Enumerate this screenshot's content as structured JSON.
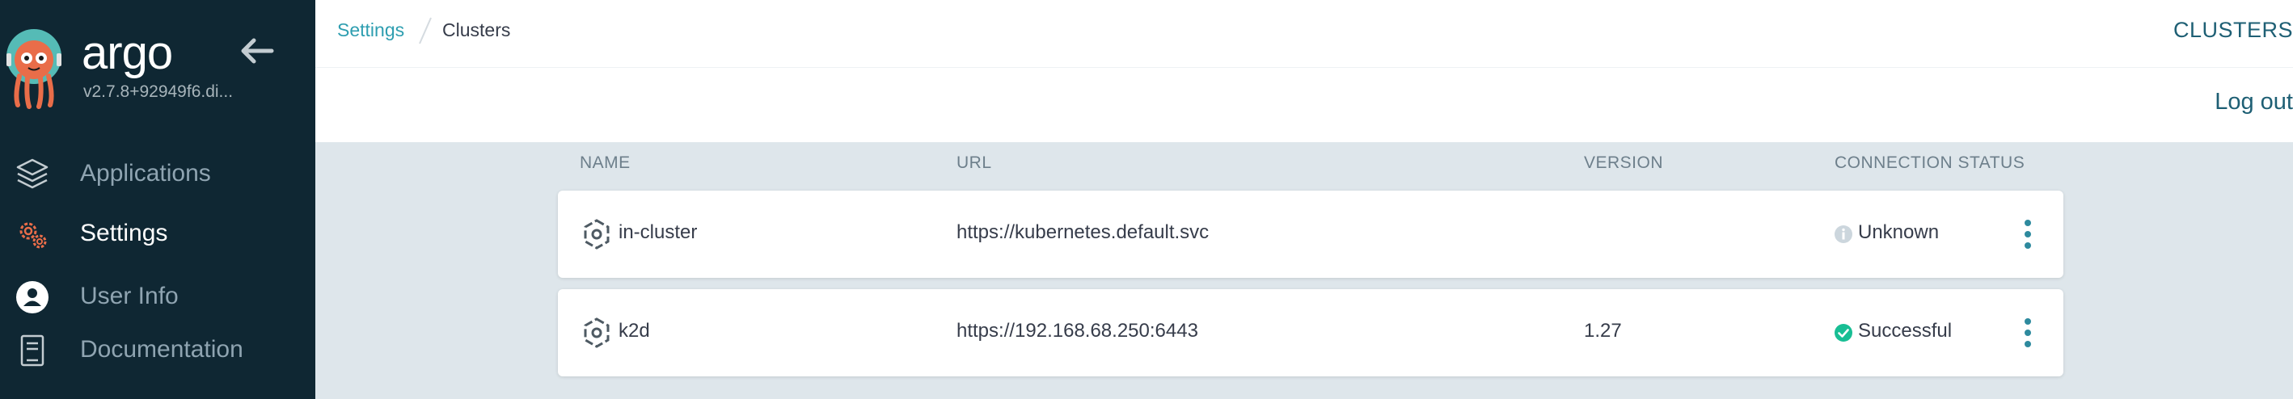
{
  "sidebar": {
    "brand": "argo",
    "version": "v2.7.8+92949f6.di...",
    "items": [
      {
        "label": "Applications",
        "icon": "layers-icon",
        "active": false
      },
      {
        "label": "Settings",
        "icon": "gears-icon",
        "active": true
      },
      {
        "label": "User Info",
        "icon": "user-circle-icon",
        "active": false
      },
      {
        "label": "Documentation",
        "icon": "book-icon",
        "active": false
      }
    ]
  },
  "breadcrumb": {
    "parent": "Settings",
    "current": "Clusters"
  },
  "header": {
    "title": "CLUSTERS",
    "logout_label": "Log out"
  },
  "table": {
    "columns": [
      "NAME",
      "URL",
      "VERSION",
      "CONNECTION STATUS"
    ],
    "rows": [
      {
        "name": "in-cluster",
        "url": "https://kubernetes.default.svc",
        "version": "",
        "status": "Unknown",
        "status_icon": "info-icon"
      },
      {
        "name": "k2d",
        "url": "https://192.168.68.250:6443",
        "version": "1.27",
        "status": "Successful",
        "status_icon": "check-circle-icon"
      }
    ]
  },
  "colors": {
    "sidebar_bg": "#0f2733",
    "accent": "#2e9eb0",
    "success": "#18be94",
    "unknown": "#ccd6dd",
    "page_bg": "#dee6eb"
  }
}
